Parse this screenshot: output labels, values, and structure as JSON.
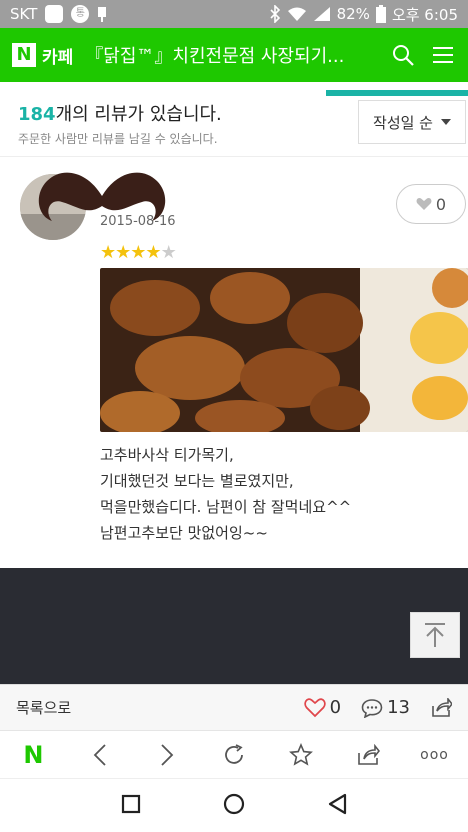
{
  "status_bar": {
    "carrier": "SKT",
    "battery": "82%",
    "time": "오후 6:05",
    "badge_text": "통"
  },
  "header": {
    "logo": "N",
    "cafe_label": "카페",
    "title": "『닭집™』치킨전문점 사장되기..."
  },
  "reviews_header": {
    "count": "184",
    "count_suffix": "개의 리뷰가 있습니다.",
    "subtitle": "주문한 사람만 리뷰를 남길 수 있습니다.",
    "sort_label": "작성일 순"
  },
  "review": {
    "date": "2015-08-16",
    "likes": "0",
    "rating": 4,
    "rating_max": 5,
    "text": "고추바사삭 티가목기,\n기대했던것 보다는 별로였지만,\n먹을만했습디다. 남편이 참 잘먹네요^^\n남편고추보단 맛없어잉~~"
  },
  "action_bar": {
    "list_label": "목록으로",
    "likes_count": "0",
    "comments_count": "13"
  },
  "browser_bar": {
    "logo": "N",
    "more_label": "ooo"
  },
  "colors": {
    "naver_green": "#1ec800",
    "teal": "#1ab3a6",
    "star": "#f4c20d"
  }
}
